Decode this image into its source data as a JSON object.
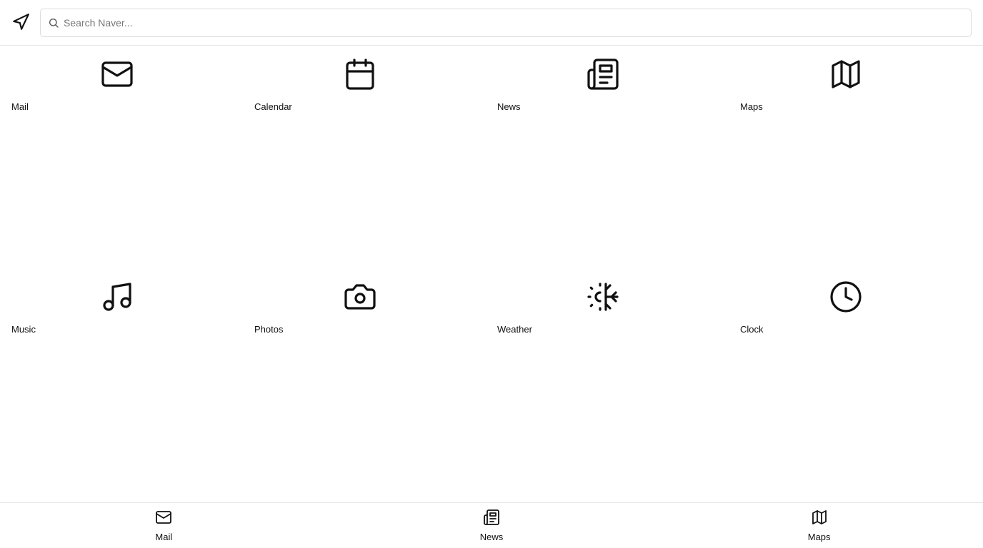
{
  "header": {
    "nav_icon": "navigation-arrow-icon",
    "search": {
      "placeholder": "Search Naver...",
      "value": "",
      "icon": "search-icon"
    }
  },
  "apps": [
    {
      "label": "Mail",
      "icon": "mail-icon"
    },
    {
      "label": "Calendar",
      "icon": "calendar-icon"
    },
    {
      "label": "News",
      "icon": "newspaper-icon"
    },
    {
      "label": "Maps",
      "icon": "map-icon"
    },
    {
      "label": "Music",
      "icon": "music-icon"
    },
    {
      "label": "Photos",
      "icon": "camera-icon"
    },
    {
      "label": "Weather",
      "icon": "sun-snow-icon"
    },
    {
      "label": "Clock",
      "icon": "clock-icon"
    }
  ],
  "bottom_nav": [
    {
      "label": "Mail",
      "icon": "mail-icon"
    },
    {
      "label": "News",
      "icon": "newspaper-icon"
    },
    {
      "label": "Maps",
      "icon": "map-icon"
    }
  ],
  "colors": {
    "icon": "#111111",
    "border": "#e5e5e5",
    "placeholder": "#777777"
  }
}
